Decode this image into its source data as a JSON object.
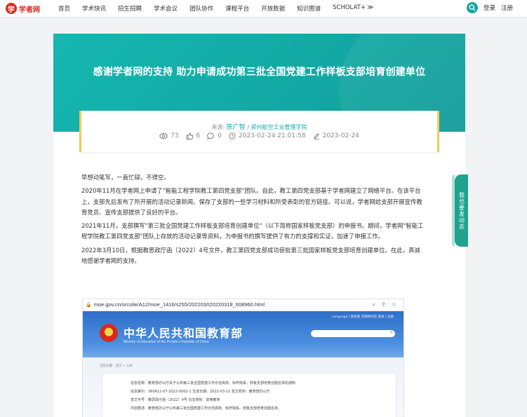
{
  "site": {
    "logo_text": "学者网",
    "logo_glyph": "学"
  },
  "nav": {
    "items": [
      "首页",
      "学术快讯",
      "招生招聘",
      "学术会议",
      "团队协作",
      "课程平台",
      "开放数据",
      "知识图谱"
    ],
    "scholat": "SCHOLAT+",
    "login": "登录",
    "register": "注册"
  },
  "article": {
    "title": "感谢学者网的支持 助力申请成功第三批全国党建工作样板支部培育创建单位",
    "source_label": "来源:",
    "author": "陈广智",
    "org": "/ 郑州航空工业管理学院",
    "views": "73",
    "likes": "6",
    "comments": "0",
    "published": "2023-02-24 21:01:58",
    "edited": "2023-02-24",
    "paragraphs": [
      "早想动笔写，一直忙碌，不得空。",
      "2020年11月在学者网上申请了\"智能工程学院教工第四党支部\"团队。自此，教工第四党支部基于学者网建立了网络平台。在该平台上，支部先后发布了所开展的活动记录新闻、保存了支部的一些学习材料和所受表彰的官方链接。可以说，学者网给支部开展宣传教育党员、宣传支部提供了良好的平台。",
      "2021年11月，支部撰写\"第三批全国党建工作样板支部培育创建单位\"（以下简称国家样板党支部）的申报书。期间，学者网\"智能工程学院教工第四党支部\"团队上存放的活动记录等资料，为申报书的撰写提供了有力的支撑和实证，加速了申报工作。",
      "2022年3月10日，根据教思政厅函〔2022〕4号文件，教工第四党支部成功获批第三批国家样板党支部培育创建单位。在此，真诚地感谢学者网的支持。"
    ]
  },
  "screenshot": {
    "url": "moe.gov.cn/srcsite/A12/moe_1416/s255/202203/t20220318_608960.html",
    "moe_title": "中华人民共和国教育部",
    "moe_subtitle": "Ministry of Education of the People's Republic of China",
    "top_links": "Language | 教育部  无障碍浏览  登录 | 注册",
    "breadcrumb": "当前位置：首页 > 公开",
    "doc_rows": [
      "信息名称：教育部办公厅关于公布第三批全国党建工作示范高校、标杆院系、样板支部培育创建名单的通知",
      "信息索引：360A12-07-2022-0002-1  生成日期：2022-03-11        发文机构：教育部办公厅",
      "发文字号：教思政厅函〔2022〕4号  信息类别：高等教育",
      "内容概述：教育部办公厅公布第三批全国党建工作示范高校、标杆院系、样板支部培育创建名单。"
    ]
  },
  "feedback": {
    "label": "我也要发动态"
  },
  "colors": {
    "teal": "#13a8a3",
    "brand_red": "#d9261c",
    "gold": "#f0cc55"
  }
}
